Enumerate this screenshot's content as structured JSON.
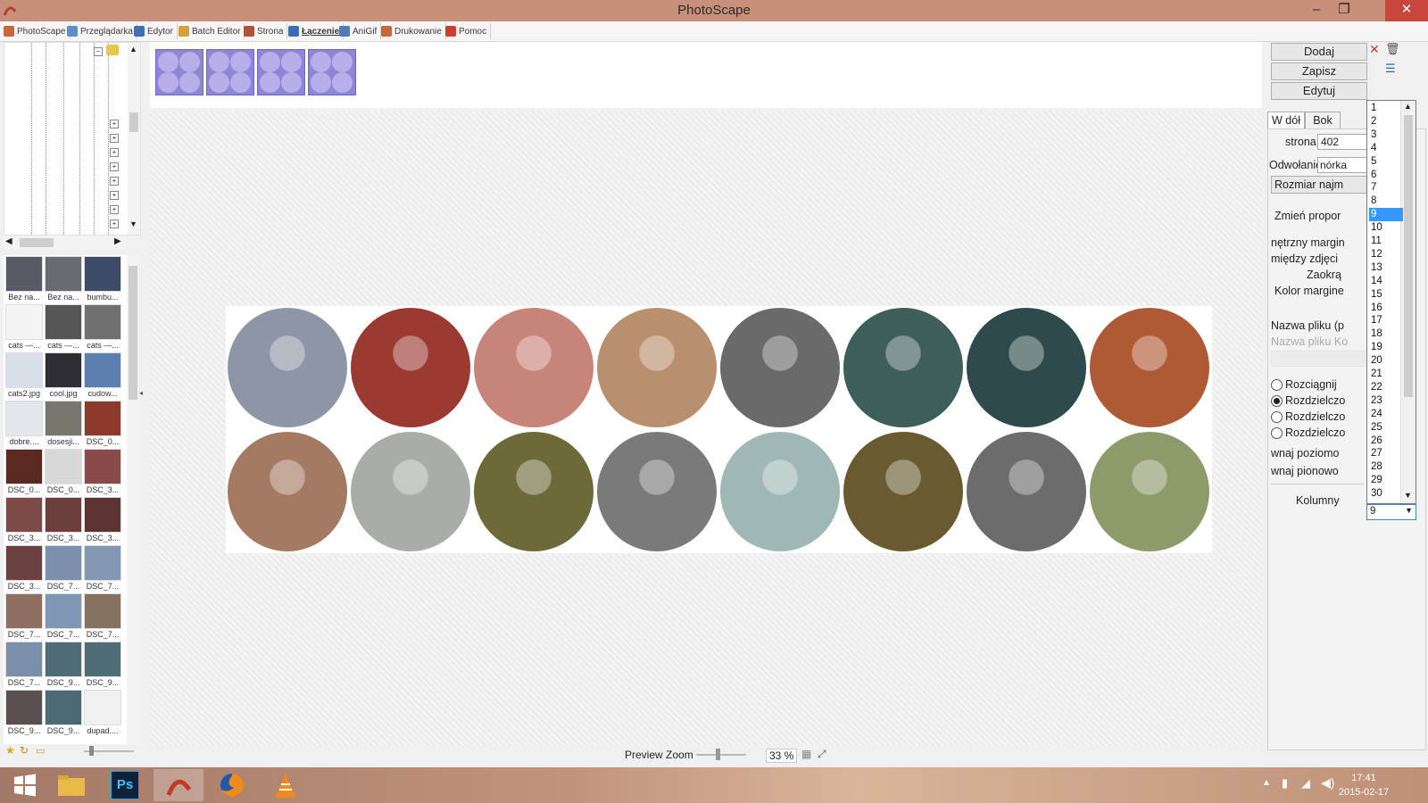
{
  "window": {
    "title": "PhotoScape",
    "minimize": "–",
    "maximize": "❐",
    "close": "✕"
  },
  "tabs": [
    {
      "label": "PhotoScape",
      "color": "#c9663b"
    },
    {
      "label": "Przeglądarka",
      "color": "#5a8fc7"
    },
    {
      "label": "Edytor",
      "color": "#3f6fb5"
    },
    {
      "label": "Batch Editor",
      "color": "#d1a23b"
    },
    {
      "label": "Strona",
      "color": "#b3503a"
    },
    {
      "label": "Łączenie",
      "color": "#3a6cb8",
      "active": true
    },
    {
      "label": "AniGif",
      "color": "#4f79b8"
    },
    {
      "label": "Drukowanie",
      "color": "#c9663b"
    },
    {
      "label": "Pomoc",
      "color": "#d23c2d"
    }
  ],
  "thumbnails": [
    {
      "label": "Bez na...",
      "color": "#5a5a66"
    },
    {
      "label": "Bez na...",
      "color": "#6a6a72"
    },
    {
      "label": "bumbu...",
      "color": "#3d4c66"
    },
    {
      "label": "cats —...",
      "color": "#f4f4f4"
    },
    {
      "label": "cats —...",
      "color": "#555555"
    },
    {
      "label": "cats —...",
      "color": "#707070"
    },
    {
      "label": "cats2.jpg",
      "color": "#d9dfe8"
    },
    {
      "label": "cool.jpg",
      "color": "#2d2d33"
    },
    {
      "label": "cudow...",
      "color": "#5c7fb0"
    },
    {
      "label": "dobre....",
      "color": "#e4e6ec"
    },
    {
      "label": "dosesji...",
      "color": "#77776e"
    },
    {
      "label": "DSC_0...",
      "color": "#8d3a2c"
    },
    {
      "label": "DSC_0...",
      "color": "#5a2a22"
    },
    {
      "label": "DSC_0...",
      "color": "#d8d8d8"
    },
    {
      "label": "DSC_3...",
      "color": "#8a4a4a"
    },
    {
      "label": "DSC_3...",
      "color": "#7d4a4a"
    },
    {
      "label": "DSC_3...",
      "color": "#6e3e3e"
    },
    {
      "label": "DSC_3...",
      "color": "#5d3434"
    },
    {
      "label": "DSC_3...",
      "color": "#6b4141"
    },
    {
      "label": "DSC_7...",
      "color": "#7a90ad"
    },
    {
      "label": "DSC_7...",
      "color": "#8398b3"
    },
    {
      "label": "DSC_7...",
      "color": "#8e6f60"
    },
    {
      "label": "DSC_7...",
      "color": "#7f96b5"
    },
    {
      "label": "DSC_7...",
      "color": "#86735f"
    },
    {
      "label": "DSC_7...",
      "color": "#7a8fa8"
    },
    {
      "label": "DSC_9...",
      "color": "#4f6b73"
    },
    {
      "label": "DSC_9...",
      "color": "#506d75"
    },
    {
      "label": "DSC_9...",
      "color": "#5a5050"
    },
    {
      "label": "DSC_9...",
      "color": "#4d6a72"
    },
    {
      "label": "dupad....",
      "color": "#f0f0f0"
    }
  ],
  "collage_colors": [
    "#8d96a6",
    "#9b3a32",
    "#c9847a",
    "#b98f6e",
    "#6a6a6a",
    "#3e5e5a",
    "#2f4a4a",
    "#b05a35",
    "#a57a63",
    "#a9aca8",
    "#6d6a3a",
    "#7a7a7a",
    "#9fb8b5",
    "#6a5a30",
    "#6c6c6c",
    "#8d9a6a"
  ],
  "right": {
    "add": "Dodaj",
    "save": "Zapisz",
    "edit": "Edytuj",
    "tab_down": "W dół",
    "tab_side": "Bok",
    "page_label": "strona",
    "page_value": "402",
    "reflect_label": "Odwołanie",
    "reflect_value": "nórka",
    "size_btn": "Rozmiar najm",
    "change_prop": "Zmień propor",
    "inner_margin": "nętrzny margin",
    "between_photos": "między zdjęci",
    "rounding": "Zaokrą",
    "margin_color": "Kolor margine",
    "file_name": "Nazwa pliku (p",
    "file_name_ph": "Nazwa pliku Ko",
    "radio1": "Rozciągnij",
    "radio2": "Rozdzielczo",
    "radio3": "Rozdzielczo",
    "radio4": "Rozdzielczo",
    "equal_h": "wnaj poziomo",
    "equal_v": "wnaj pionowo",
    "columns_label": "Kolumny",
    "columns_value": "9"
  },
  "columns_options": [
    "1",
    "2",
    "3",
    "4",
    "5",
    "6",
    "7",
    "8",
    "9",
    "10",
    "11",
    "12",
    "13",
    "14",
    "15",
    "16",
    "17",
    "18",
    "19",
    "20",
    "21",
    "22",
    "23",
    "24",
    "25",
    "26",
    "27",
    "28",
    "29",
    "30"
  ],
  "bottom": {
    "zoom_label": "Preview Zoom",
    "zoom_value": "33 %"
  },
  "taskbar": {
    "time": "17:41",
    "date": "2015-02-17",
    "ps": "Ps"
  }
}
